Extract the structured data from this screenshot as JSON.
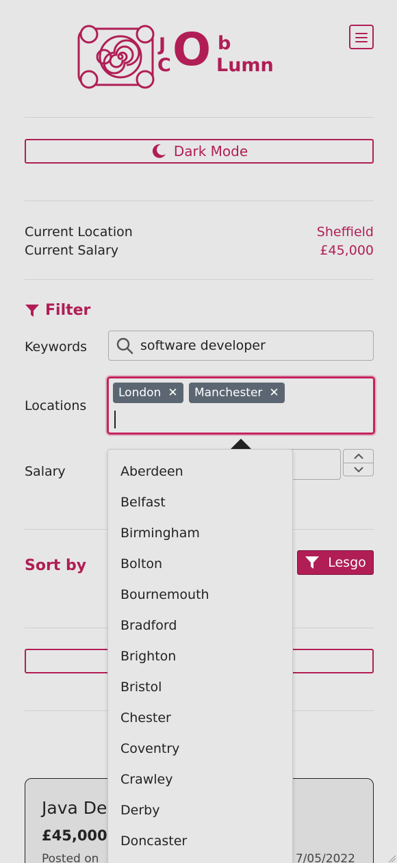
{
  "header": {
    "logo_letters": {
      "j": "J",
      "c": "C",
      "o": "O",
      "b": "b",
      "lumn": "Lumn"
    },
    "menu_icon": "hamburger-menu-icon"
  },
  "theme": {
    "toggle_label": "Dark Mode",
    "toggle_icon": "moon-icon"
  },
  "profile": {
    "location_label": "Current Location",
    "location_value": "Sheffield",
    "salary_label": "Current Salary",
    "salary_value": "£45,000"
  },
  "filter": {
    "title": "Filter",
    "title_icon": "filter-icon",
    "keywords_label": "Keywords",
    "keywords_value": "software developer",
    "keywords_icon": "search-icon",
    "locations_label": "Locations",
    "locations_selected": [
      "London",
      "Manchester"
    ],
    "salary_label": "Salary",
    "location_options": [
      "Aberdeen",
      "Belfast",
      "Birmingham",
      "Bolton",
      "Bournemouth",
      "Bradford",
      "Brighton",
      "Bristol",
      "Chester",
      "Coventry",
      "Crawley",
      "Derby",
      "Doncaster"
    ]
  },
  "sort": {
    "title": "Sort by",
    "submit_label": "Lesgo",
    "submit_icon": "filter-icon"
  },
  "job": {
    "title_visible": "Java De",
    "salary_visible": "£45,000",
    "posted_visible": "Posted on",
    "date_visible": "7/05/2022"
  },
  "colors": {
    "accent": "#b01e55",
    "tag_bg": "#5b6672",
    "background": "#e6e6e6"
  }
}
